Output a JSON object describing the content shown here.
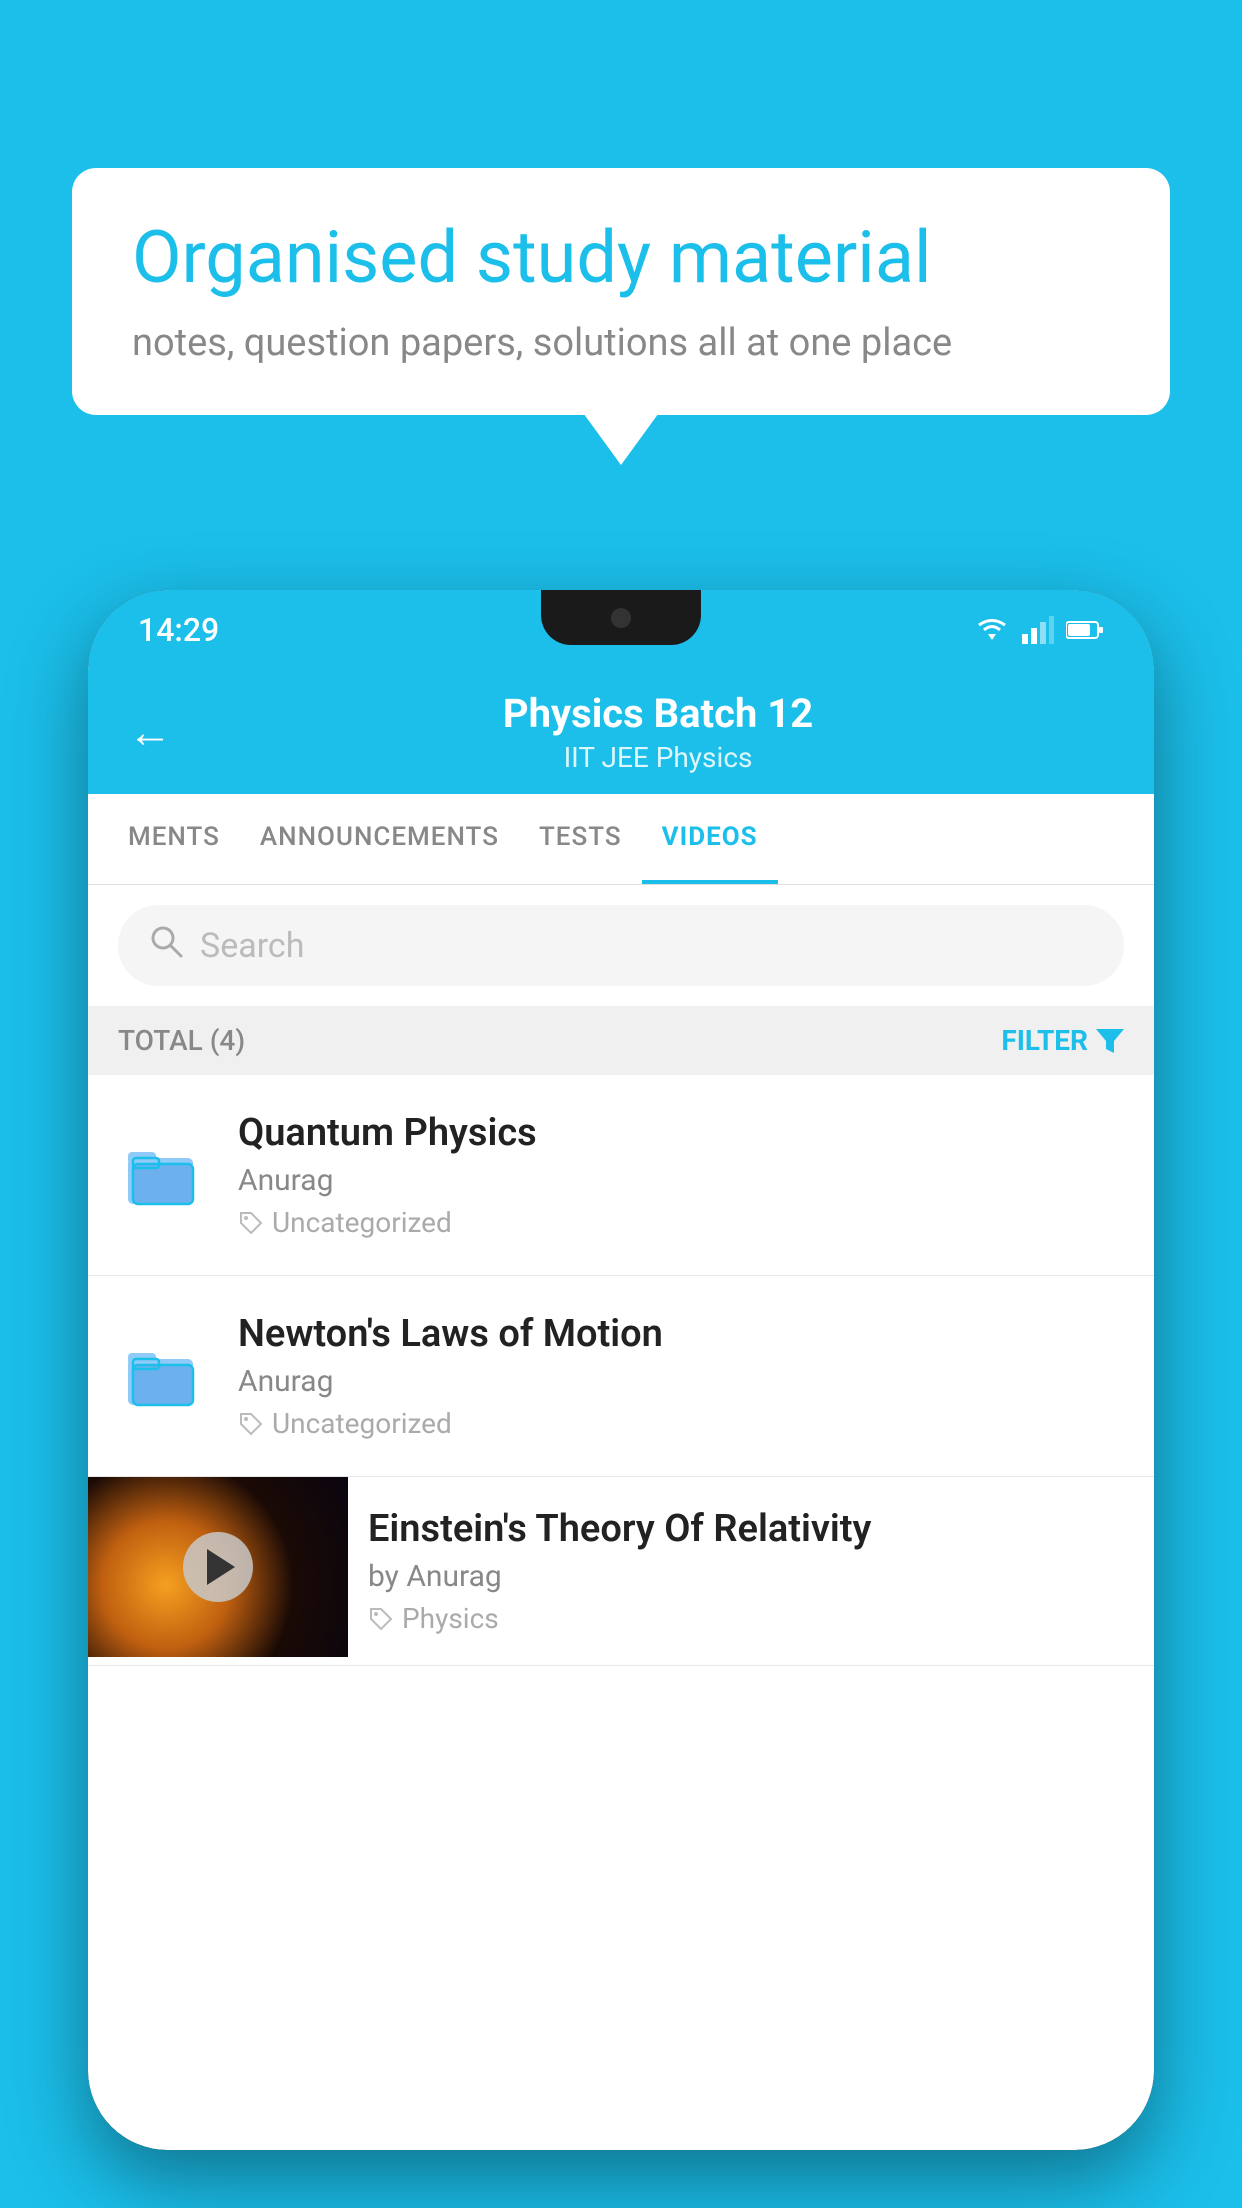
{
  "background_color": "#1BBFEA",
  "speech_bubble": {
    "title": "Organised study material",
    "subtitle": "notes, question papers, solutions all at one place"
  },
  "phone": {
    "status_bar": {
      "time": "14:29"
    },
    "header": {
      "title": "Physics Batch 12",
      "subtitle": "IIT JEE   Physics",
      "back_label": "←"
    },
    "tabs": [
      {
        "label": "MENTS",
        "active": false
      },
      {
        "label": "ANNOUNCEMENTS",
        "active": false
      },
      {
        "label": "TESTS",
        "active": false
      },
      {
        "label": "VIDEOS",
        "active": true
      }
    ],
    "search": {
      "placeholder": "Search"
    },
    "filter": {
      "total_label": "TOTAL (4)",
      "filter_label": "FILTER"
    },
    "list_items": [
      {
        "type": "folder",
        "title": "Quantum Physics",
        "author": "Anurag",
        "tag": "Uncategorized"
      },
      {
        "type": "folder",
        "title": "Newton's Laws of Motion",
        "author": "Anurag",
        "tag": "Uncategorized"
      },
      {
        "type": "video",
        "title": "Einstein's Theory Of Relativity",
        "author": "by Anurag",
        "tag": "Physics"
      }
    ]
  }
}
